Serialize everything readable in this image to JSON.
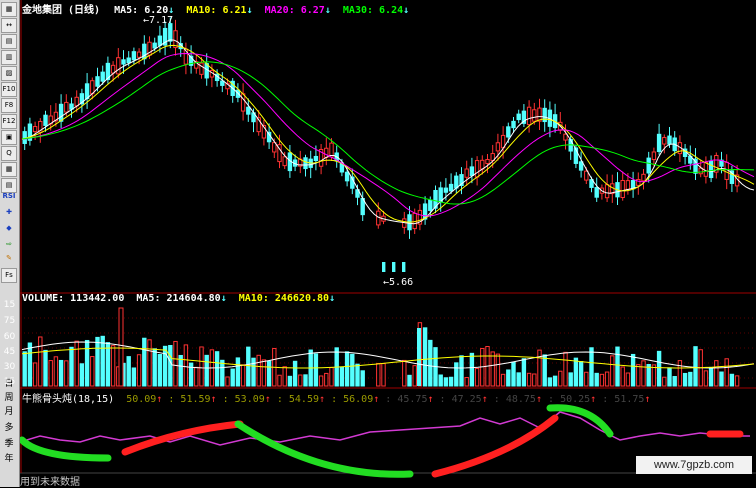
{
  "main_panel": {
    "title": "金地集团 (日线)",
    "ma5": "MA5: 6.20",
    "ma10": "MA10: 6.21",
    "ma20": "MA20: 6.27",
    "ma30": "MA30: 6.24",
    "high_label": "7.17",
    "low_label": "5.66"
  },
  "volume_panel": {
    "label": "VOLUME: 113442.00",
    "ma5": "MA5: 214604.80",
    "ma10": "MA10: 246620.80",
    "y_ticks": [
      "15",
      "75",
      "60",
      "45",
      "30",
      "15"
    ]
  },
  "indicator_panel": {
    "label": "牛熊骨头炖(18,15)",
    "values": [
      "50.09",
      "51.59",
      "53.09",
      "54.59",
      "56.09",
      "45.75",
      "47.25",
      "48.75",
      "50.25",
      "51.75"
    ]
  },
  "sidebar": {
    "items": [
      "F10",
      "F8",
      "F12",
      "Q",
      "Fs",
      "RSI"
    ],
    "periods": [
      "日",
      "周",
      "月",
      "多",
      "季",
      "年"
    ]
  },
  "footer": {
    "text": "用到未来数据"
  },
  "watermark": {
    "text": "www.7gpzb.com"
  },
  "colors": {
    "bull": "#ff3232",
    "bear": "#54ffff",
    "ma5": "#ffffff",
    "ma10": "#ffff00",
    "ma20": "#ff00ff",
    "ma30": "#00ff00",
    "axis": "#a00000"
  },
  "icons": [
    "arrow-down-icon",
    "arrow-up-icon",
    "plus-icon",
    "diamond-icon",
    "pencil-icon"
  ]
}
